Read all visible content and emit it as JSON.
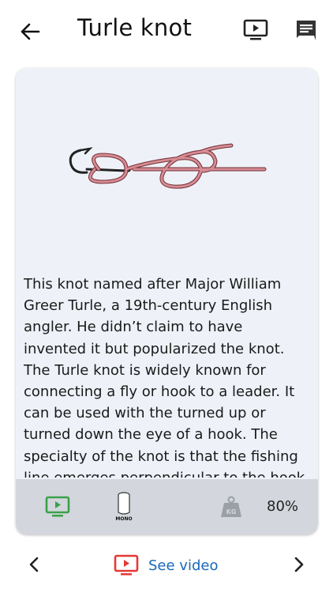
{
  "header": {
    "title": "Turle knot"
  },
  "card": {
    "description": "This knot named after Major William Greer Turle, a 19th-century English angler. He didn’t claim to have invented it but popularized the knot. The Turle knot is widely known for connecting a fly or hook to a leader. It can be used with the turned up or turned down the eye of a hook. The specialty of the knot is that the fishing line emerges perpendicular to the hook shaft. Due to",
    "footer": {
      "line_type": "MONO",
      "weight_unit": "KG",
      "strength": "80%"
    }
  },
  "bottom": {
    "see_video_label": "See video"
  },
  "colors": {
    "green_accent": "#3aa14a",
    "red_accent": "#e53935",
    "link_blue": "#1a68b8",
    "card_bg": "#eef2f8",
    "footer_bg": "#d3d6dc"
  },
  "icons": [
    "arrow-back-icon",
    "tv-play-icon",
    "comment-icon",
    "knot-illustration",
    "play-green-icon",
    "mono-line-icon",
    "kg-weight-icon",
    "chevron-left-icon",
    "play-red-icon",
    "chevron-right-icon"
  ]
}
